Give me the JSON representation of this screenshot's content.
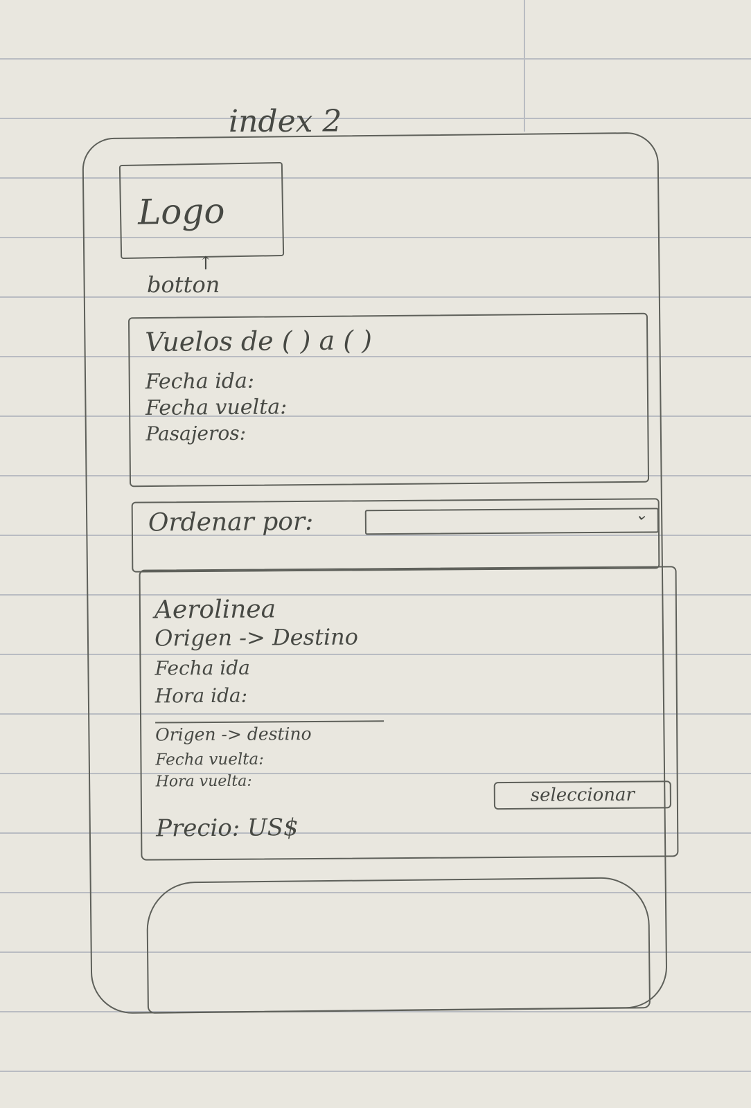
{
  "page": {
    "title": "index 2"
  },
  "header": {
    "logo_text": "Logo",
    "logo_arrow": "↑",
    "logo_button_label": "botton"
  },
  "search": {
    "route_line": "Vuelos de (      ) a (      )",
    "departure_date": "Fecha ida:",
    "return_date": "Fecha vuelta:",
    "passengers": "Pasajeros:"
  },
  "sort": {
    "label": "Ordenar por:",
    "selected_value": "",
    "chevron": "⌄"
  },
  "flight_card": {
    "airline": "Aerolinea",
    "outbound_route": "Origen -> Destino",
    "outbound_date": "Fecha ida",
    "outbound_time": "Hora ida:",
    "return_route": "Origen -> destino",
    "return_date": "Fecha vuelta:",
    "return_time": "Hora vuelta:",
    "price": "Precio: US$",
    "select_button": "seleccionar"
  }
}
